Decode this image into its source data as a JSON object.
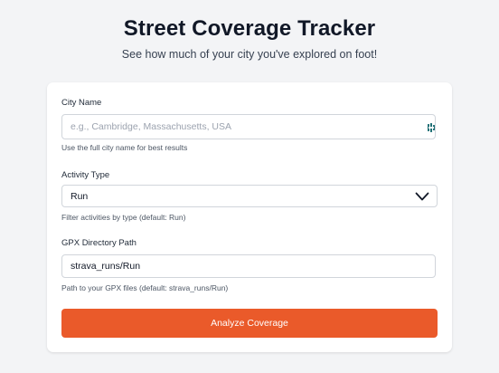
{
  "header": {
    "title": "Street Coverage Tracker",
    "subtitle": "See how much of your city you've explored on foot!"
  },
  "form": {
    "city": {
      "label": "City Name",
      "value": "",
      "placeholder": "e.g., Cambridge, Massachusetts, USA",
      "hint": "Use the full city name for best results",
      "autofill_icon": "password-manager-icon"
    },
    "activity": {
      "label": "Activity Type",
      "selected": "Run",
      "hint": "Filter activities by type (default: Run)",
      "icon": "chevron-down-icon"
    },
    "gpx": {
      "label": "GPX Directory Path",
      "value": "strava_runs/Run",
      "hint": "Path to your GPX files (default: strava_runs/Run)"
    },
    "submit_label": "Analyze Coverage"
  },
  "colors": {
    "background": "#f3f4f6",
    "card": "#ffffff",
    "accent": "#ea5a2a"
  }
}
